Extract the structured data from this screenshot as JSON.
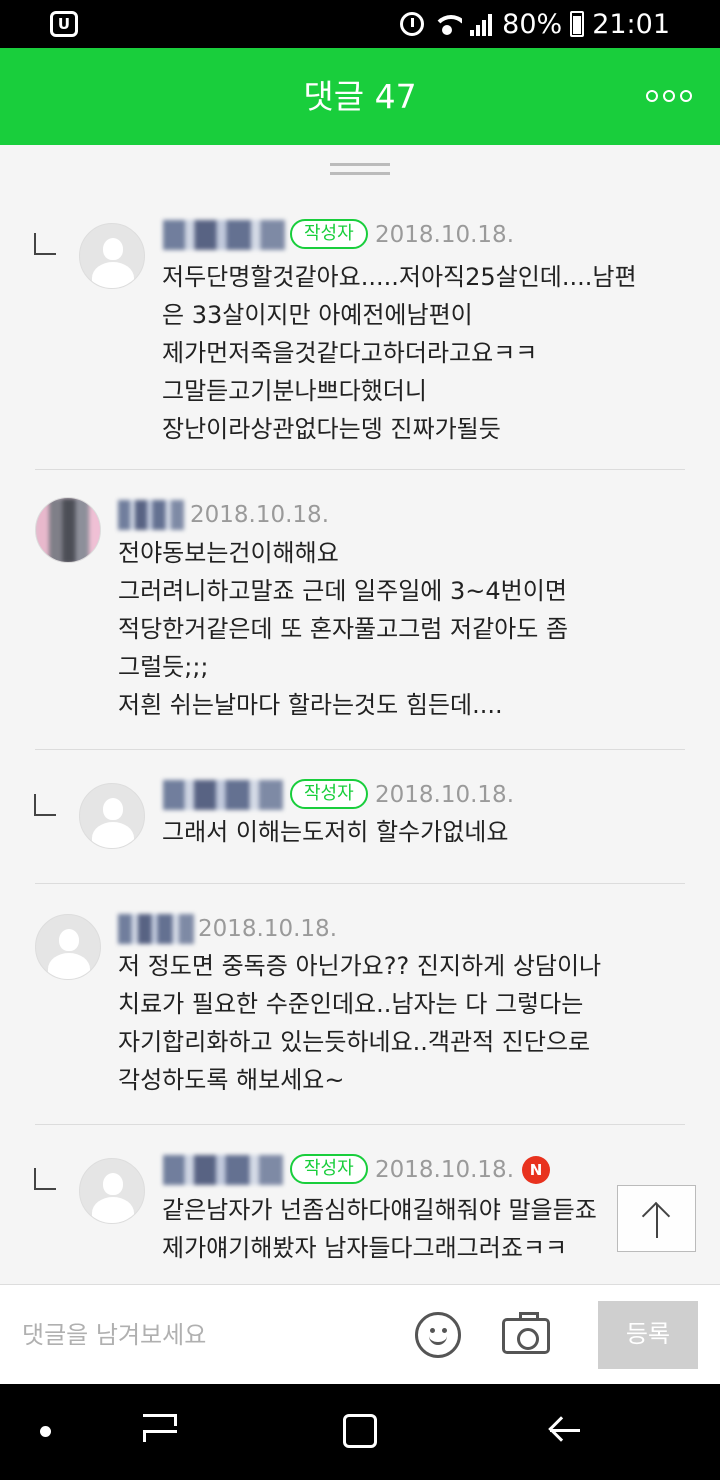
{
  "status_bar": {
    "battery": "80%",
    "time": "21:01"
  },
  "header": {
    "title": "댓글 47",
    "more_icon": "more-horizontal-icon"
  },
  "comments": [
    {
      "is_reply": true,
      "author_badge": "작성자",
      "date": "2018.10.18.",
      "lines": [
        "저두단명할것같아요.....저아직25살인데....남편",
        "은 33살이지만 아예전에남편이",
        "제가먼저죽을것같다고하더라고요ㅋㅋ",
        "그말듣고기분나쁘다했더니",
        "장난이라상관없다는뎅 진짜가될듯"
      ]
    },
    {
      "is_reply": false,
      "date": "2018.10.18.",
      "lines": [
        "전야동보는건이해해요",
        "그러려니하고말죠 근데 일주일에 3~4번이면",
        "적당한거같은데 또 혼자풀고그럼 저같아도 좀",
        "그럴듯;;;",
        "저흰 쉬는날마다 할라는것도 힘든데...."
      ]
    },
    {
      "is_reply": true,
      "author_badge": "작성자",
      "date": "2018.10.18.",
      "lines": [
        "그래서 이해는도저히 할수가없네요"
      ]
    },
    {
      "is_reply": false,
      "date": "2018.10.18.",
      "lines": [
        "저 정도면 중독증 아닌가요?? 진지하게 상담이나",
        "치료가 필요한 수준인데요..남자는 다 그렇다는",
        "자기합리화하고 있는듯하네요..객관적 진단으로",
        "각성하도록 해보세요~"
      ]
    },
    {
      "is_reply": true,
      "author_badge": "작성자",
      "date": "2018.10.18.",
      "new_badge": "N",
      "lines": [
        "같은남자가 넌좀심하다얘길해줘야 말을듣죠",
        "제가얘기해봤자 남자들다그래그러죠ㅋㅋ"
      ]
    }
  ],
  "input_bar": {
    "placeholder": "댓글을 남겨보세요",
    "emoji_icon": "emoji-smile-icon",
    "camera_icon": "camera-icon",
    "submit_label": "등록"
  },
  "scroll_top_icon": "arrow-up-icon"
}
